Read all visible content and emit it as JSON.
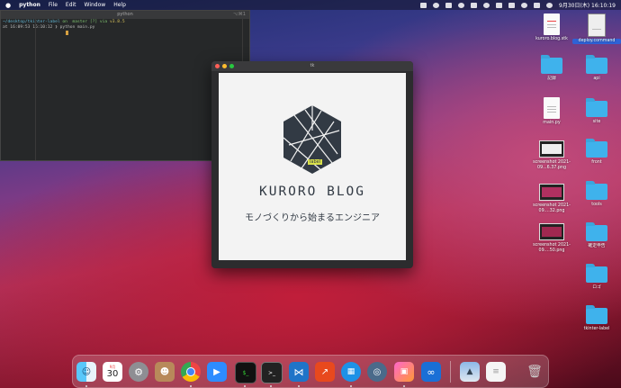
{
  "menubar": {
    "app_name": "python",
    "items": [
      "File",
      "Edit",
      "Window",
      "Help"
    ],
    "datetime": "9月30日(木) 16:10:19"
  },
  "terminal": {
    "title": "python",
    "shortcut": "⌥⌘1",
    "line1_path": "~/desktop/tkinter-label",
    "line1_git": "on  master [?] via",
    "line1_version": "v3.8.5",
    "line2_time": "at 16:09:53 16:10:12",
    "line2_cmd": "❯ python main.py"
  },
  "tk_window": {
    "title": "tk",
    "logo_label": "label",
    "brand": "KURORO BLOG",
    "tagline": "モノづくりから始まるエンジニア"
  },
  "desktop": {
    "col1": [
      {
        "label": "kuroro.blog.stk",
        "kind": "doc"
      },
      {
        "label": "記録",
        "kind": "folder"
      },
      {
        "label": "main.py",
        "kind": "doc"
      },
      {
        "label": "screenshot 2021-09...6.37.png",
        "kind": "shot"
      },
      {
        "label": "screenshot 2021-09....32.png",
        "kind": "shot"
      },
      {
        "label": "screenshot 2021-09....50.png",
        "kind": "shot"
      }
    ],
    "col2": [
      {
        "label": "deploy.command",
        "kind": "doc"
      },
      {
        "label": "api",
        "kind": "folder"
      },
      {
        "label": "site",
        "kind": "folder"
      },
      {
        "label": "front",
        "kind": "folder"
      },
      {
        "label": "tools",
        "kind": "folder"
      },
      {
        "label": "確定申告",
        "kind": "folder"
      },
      {
        "label": "ロゴ",
        "kind": "folder"
      },
      {
        "label": "tkinter-label",
        "kind": "folder"
      }
    ]
  },
  "dock": {
    "calendar_month": "9月",
    "calendar_day": "30",
    "apps": [
      "finder",
      "calendar",
      "system-preferences",
      "contacts",
      "chrome",
      "zoom",
      "iterm",
      "terminal",
      "vscode",
      "git-client",
      "docker",
      "quicktime",
      "preview",
      "infinity-app",
      "photos",
      "document",
      "trash"
    ]
  },
  "colors": {
    "folder": "#3fb2ec",
    "brand_dark": "#323a44",
    "accent_label": "#d8e04a"
  }
}
